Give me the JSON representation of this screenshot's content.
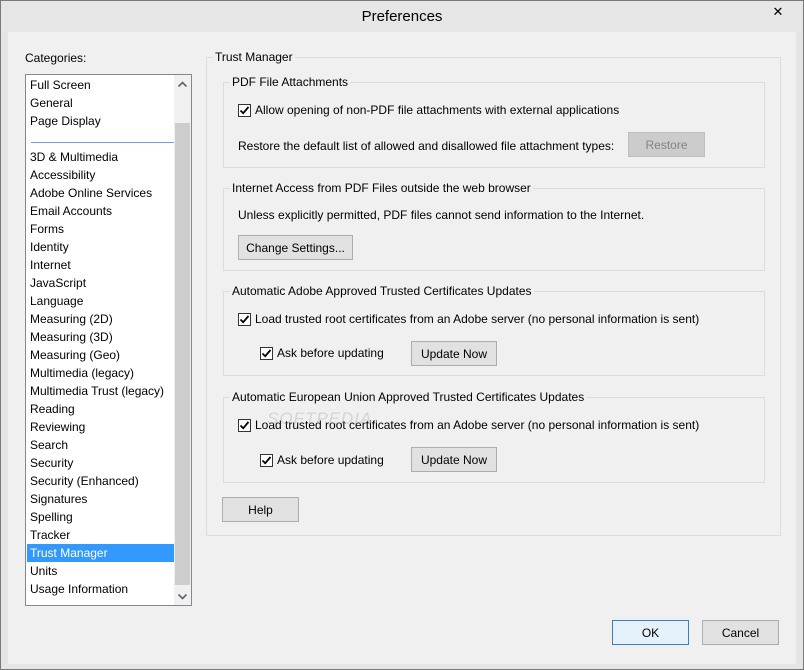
{
  "window": {
    "title": "Preferences",
    "close_glyph": "✕"
  },
  "categories": {
    "label": "Categories:",
    "top_items": [
      "Full Screen",
      "General",
      "Page Display"
    ],
    "items": [
      "3D & Multimedia",
      "Accessibility",
      "Adobe Online Services",
      "Email Accounts",
      "Forms",
      "Identity",
      "Internet",
      "JavaScript",
      "Language",
      "Measuring (2D)",
      "Measuring (3D)",
      "Measuring (Geo)",
      "Multimedia (legacy)",
      "Multimedia Trust (legacy)",
      "Reading",
      "Reviewing",
      "Search",
      "Security",
      "Security (Enhanced)",
      "Signatures",
      "Spelling",
      "Tracker",
      "Trust Manager",
      "Units",
      "Usage Information"
    ],
    "selected": "Trust Manager"
  },
  "trust_manager": {
    "title": "Trust Manager",
    "pdf_attachments": {
      "legend": "PDF File Attachments",
      "allow_label": "Allow opening of non-PDF file attachments with external applications",
      "allow_checked": true,
      "restore_text": "Restore the default list of allowed and disallowed file attachment types:",
      "restore_button": "Restore"
    },
    "internet_access": {
      "legend": "Internet Access from PDF Files outside the web browser",
      "info_text": "Unless explicitly permitted, PDF files cannot send information to the Internet.",
      "change_button": "Change Settings..."
    },
    "adobe_certs": {
      "legend": "Automatic Adobe Approved Trusted Certificates Updates",
      "load_label": "Load trusted root certificates from an Adobe server (no personal information is sent)",
      "load_checked": true,
      "ask_label": "Ask before updating",
      "ask_checked": true,
      "update_button": "Update Now"
    },
    "eu_certs": {
      "legend": "Automatic European Union Approved Trusted Certificates Updates",
      "load_label": "Load trusted root certificates from an Adobe server (no personal information is sent)",
      "load_checked": true,
      "ask_label": "Ask before updating",
      "ask_checked": true,
      "update_button": "Update Now"
    },
    "help_button": "Help"
  },
  "footer": {
    "ok_button": "OK",
    "cancel_button": "Cancel"
  },
  "watermark": "SOFTPEDIA"
}
